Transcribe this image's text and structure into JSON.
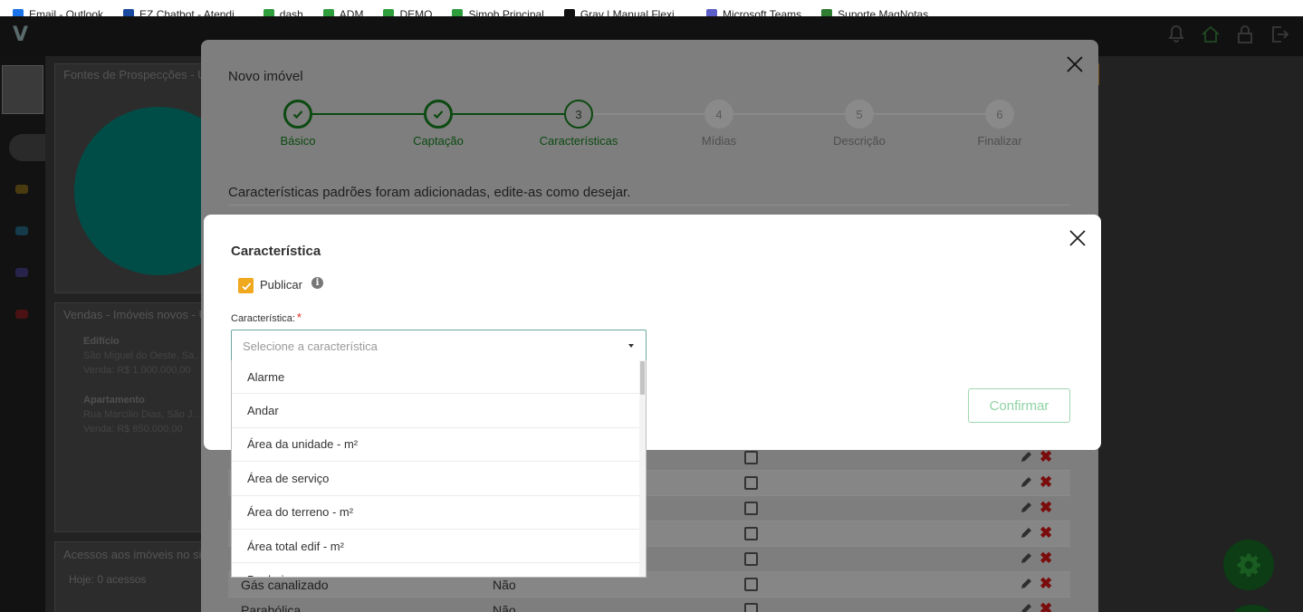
{
  "browser": {
    "bookmarks": [
      {
        "label": "Email - Outlook",
        "icon": "outlook-icon",
        "color": "#1a73e8"
      },
      {
        "label": "EZ Chatbot - Atendi...",
        "icon": "chatbot-icon",
        "color": "#1a4aa0"
      },
      {
        "label": "dash",
        "icon": "green-arrow-icon",
        "color": "#2e9e3c"
      },
      {
        "label": "ADM",
        "icon": "green-arrow-icon",
        "color": "#2e9e3c"
      },
      {
        "label": "DEMO",
        "icon": "green-arrow-icon",
        "color": "#2e9e3c"
      },
      {
        "label": "Simob Principal",
        "icon": "green-arrow-icon",
        "color": "#2e9e3c"
      },
      {
        "label": "Grav | Manual Flexi ...",
        "icon": "grav-icon",
        "color": "#111111"
      },
      {
        "label": "Microsoft Teams",
        "icon": "teams-icon",
        "color": "#5b5fc7"
      },
      {
        "label": "Suporte MagNotas",
        "icon": "magnotas-icon",
        "color": "#2e7d32"
      }
    ]
  },
  "app": {
    "logo": "V",
    "cards": {
      "prospeccoes_title": "Fontes de Prospecções - U",
      "vendas_title": "Vendas - Imóveis novos - U",
      "acessos_title": "Acessos aos imóveis no sit",
      "acessos_hoje": "Hoje: 0 acessos"
    },
    "properties": [
      {
        "type": "Edifício",
        "address": "São Miguel do Oeste, Sa...",
        "price": "Venda: R$ 1.000.000,00"
      },
      {
        "type": "Apartamento",
        "address": "Rua Marcilio Dias, São J...",
        "price": "Venda: R$ 850.000,00"
      }
    ]
  },
  "novo_imovel": {
    "title": "Novo imóvel",
    "steps": [
      {
        "label": "Básico",
        "status": "done"
      },
      {
        "label": "Captação",
        "status": "done"
      },
      {
        "label": "Características",
        "number": "3",
        "status": "active"
      },
      {
        "label": "Mídias",
        "number": "4",
        "status": "pending"
      },
      {
        "label": "Descrição",
        "number": "5",
        "status": "pending"
      },
      {
        "label": "Finalizar",
        "number": "6",
        "status": "pending"
      }
    ],
    "hint": "Características padrões foram adicionadas, edite-as como desejar.",
    "rows": [
      {
        "name": "",
        "value": ""
      },
      {
        "name": "",
        "value": ""
      },
      {
        "name": "",
        "value": ""
      },
      {
        "name": "",
        "value": ""
      },
      {
        "name": "",
        "value": ""
      },
      {
        "name": "Gás canalizado",
        "value": "Não"
      },
      {
        "name": "Parabólica",
        "value": "Não"
      }
    ]
  },
  "caracteristica_modal": {
    "title": "Característica",
    "publish_label": "Publicar",
    "publish_checked": true,
    "field_label": "Característica:",
    "required_mark": "*",
    "select_placeholder": "Selecione a característica",
    "options": [
      "Alarme",
      "Andar",
      "Área da unidade - m²",
      "Área de serviço",
      "Área do terreno - m²",
      "Área total edif - m²",
      "Banheiros"
    ],
    "confirm_label": "Confirmar"
  },
  "colors": {
    "step_done": "#0b4a10",
    "accent_orange": "#f0a81e",
    "select_border": "#6aa7a2",
    "confirm_text": "#8ed3a4",
    "delete_red": "#7a0c0c"
  }
}
